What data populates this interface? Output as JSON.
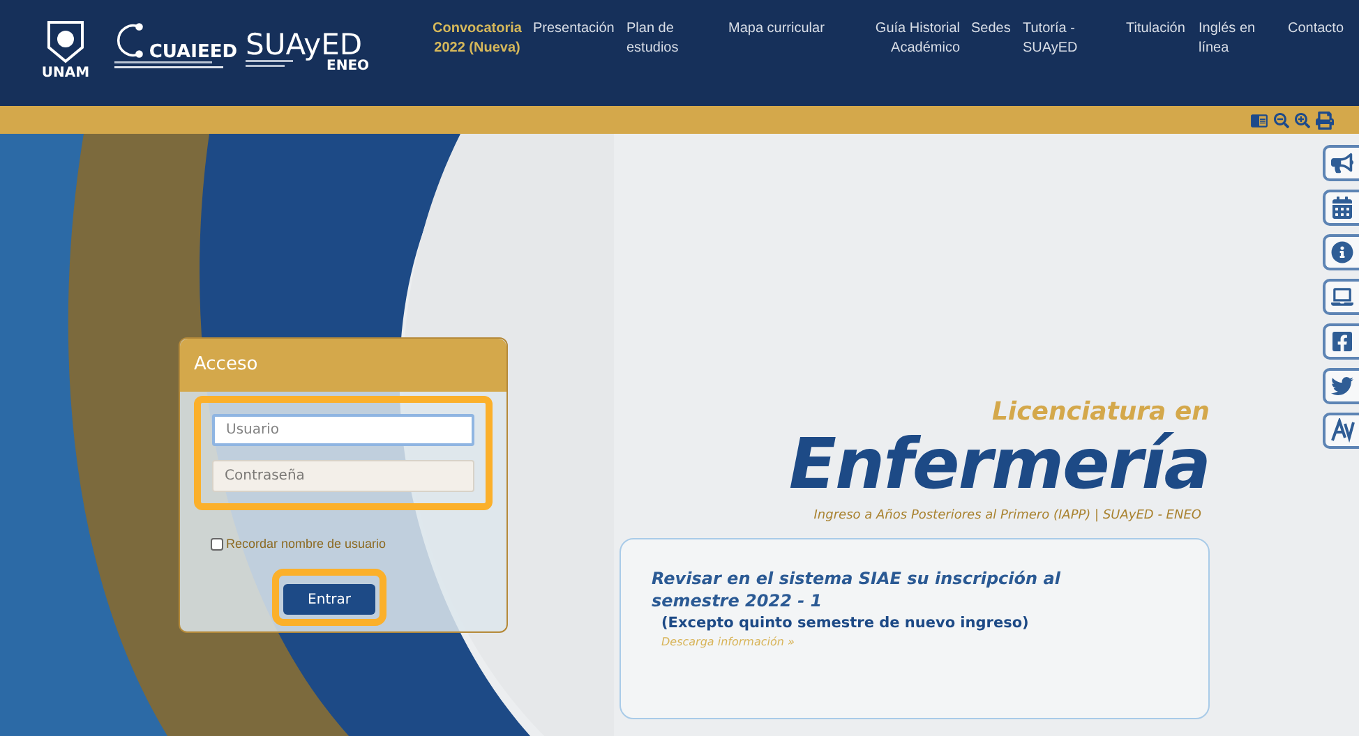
{
  "header": {
    "logos": {
      "unam": "UNAM",
      "cuaieed": "CUAIEED",
      "suayed": "SUAyED",
      "eneo": "ENEO"
    },
    "nav": [
      {
        "label": "Convocatoria 2022 (Nueva)",
        "selected": true
      },
      {
        "label": "Presentación",
        "selected": false
      },
      {
        "label": "Plan de estudios",
        "selected": false
      },
      {
        "label": "Mapa curricular",
        "selected": false
      },
      {
        "label": "Guía Historial Académico",
        "selected": false
      },
      {
        "label": "Sedes",
        "selected": false
      },
      {
        "label": "Tutoría - SUAyED",
        "selected": false
      },
      {
        "label": "Titulación",
        "selected": false
      },
      {
        "label": "Inglés en línea",
        "selected": false
      },
      {
        "label": "Contacto",
        "selected": false
      }
    ]
  },
  "login": {
    "title": "Acceso",
    "username": {
      "placeholder": "Usuario",
      "focused": true
    },
    "password": {
      "placeholder": "Contraseña"
    },
    "remember": {
      "label": "Recordar nombre de usuario",
      "checked": false
    },
    "submit": "Entrar"
  },
  "hero": {
    "kicker": "Licenciatura en",
    "title": "Enfermería",
    "subtitle": "Ingreso a Años Posteriores al Primero (IAPP) | SUAyED - ENEO"
  },
  "notice": {
    "title": "Revisar en el sistema SIAE su inscripción al semestre 2022 - 1",
    "note": "(Excepto quinto semestre de nuevo ingreso)",
    "link": "Descarga información »"
  }
}
